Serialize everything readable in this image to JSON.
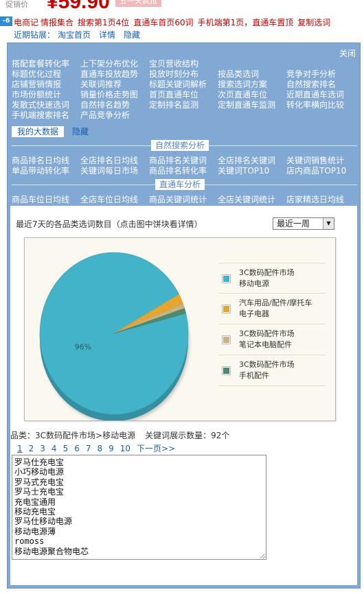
{
  "product": {
    "price_label": "促销价",
    "price": "¥59.90",
    "promo_badge": "五一天疯抢"
  },
  "plugin_bar": {
    "logo": "-6",
    "links": [
      "电商记",
      "情报集合",
      "搜索第1页4位",
      "直通车首页60词",
      "手机端第1页，直通车置顶",
      "复制选词"
    ]
  },
  "quick_bar": {
    "label": "近期钻展：",
    "links": [
      "淘宝首页",
      "详情",
      "隐藏"
    ]
  },
  "panel": {
    "close_label": "关闭",
    "feature_rows": [
      [
        "搭配套餐转化率",
        "上下架分布优化",
        "宝贝营收结构",
        "",
        ""
      ],
      [
        "标题优化过程",
        "直通车投放趋势",
        "投放时刻分布",
        "按品类选词",
        "竞争对手分析"
      ],
      [
        "店铺营销情报",
        "关联词推荐",
        "标题关键词解析",
        "搜索选词方案",
        "自然搜索排名"
      ],
      [
        "市场份额统计",
        "销量价格走势图",
        "首页直通车位",
        "次页直通车位",
        "近期直通车选词"
      ],
      [
        "发散式快速选词",
        "自然排名趋势",
        "定制排名监测",
        "定制直通车监测",
        "转化率横向比较"
      ],
      [
        "手机端搜索排名",
        "产品竞争分析",
        "",
        "",
        ""
      ]
    ],
    "tabs": {
      "active": "我的大数据",
      "hide": "隐藏"
    },
    "natural_search": {
      "title": "自然搜索分析",
      "rows": [
        [
          "商品排名日均线",
          "全店排名日均线",
          "商品排名关键词",
          "全店排名关键词",
          "关键词销售统计"
        ],
        [
          "单品带动转化率",
          "关键词每日市场",
          "商品排名转化率",
          "关键词TOP10",
          "店内商品TOP10"
        ]
      ]
    },
    "through_train": {
      "title": "直通车分析",
      "rows": [
        [
          "商品车位日均线",
          "全店车位日均线",
          "商品关键词统计",
          "全店关键词统计",
          "店家精选日均线"
        ]
      ]
    }
  },
  "content": {
    "title": "最近7天的各品类选词数目（点击图中饼块看详情）",
    "period": {
      "selected": "最近一周",
      "arrow_icon": "chevron-down-icon"
    },
    "category_line": {
      "category": "品类：3C数码配件市场>移动电源",
      "keyword_count": "关键词展示数量：92个"
    },
    "pager": {
      "pages": [
        "1",
        "2",
        "3",
        "4",
        "5",
        "6",
        "7",
        "8",
        "9",
        "10"
      ],
      "current": "1",
      "next_label": "下一页>>"
    },
    "keywords": [
      "罗马仕充电宝",
      "小巧移动电源",
      "罗马式充电宝",
      "罗马士充电宝",
      "充电宝通用",
      "移动充电宝",
      "罗马仕移动电源",
      "移动电源薄",
      "romoss",
      "移动电源聚合物电芯"
    ]
  },
  "chart_data": {
    "type": "pie",
    "title": "",
    "slice_label": "96%",
    "slices": [
      {
        "name": "3C数码配件市场>移动电源",
        "legend_lines": [
          "3C数码配件市场",
          "移动电源"
        ],
        "value": 96,
        "color": "#43b3c9"
      },
      {
        "name": "汽车用品/配件/摩托车>电子电器",
        "legend_lines": [
          "汽车用品/配件/摩托车",
          "电子电器"
        ],
        "value": 2,
        "color": "#e6a52e"
      },
      {
        "name": "3C数码配件市场>笔记本电脑配件",
        "legend_lines": [
          "3C数码配件市场",
          "笔记本电脑配件"
        ],
        "value": 1,
        "color": "#c9b383"
      },
      {
        "name": "3C数码配件市场>手机配件",
        "legend_lines": [
          "3C数码配件市场",
          "手机配件"
        ],
        "value": 1,
        "color": "#4a8b72"
      }
    ],
    "legend_position": "right"
  }
}
